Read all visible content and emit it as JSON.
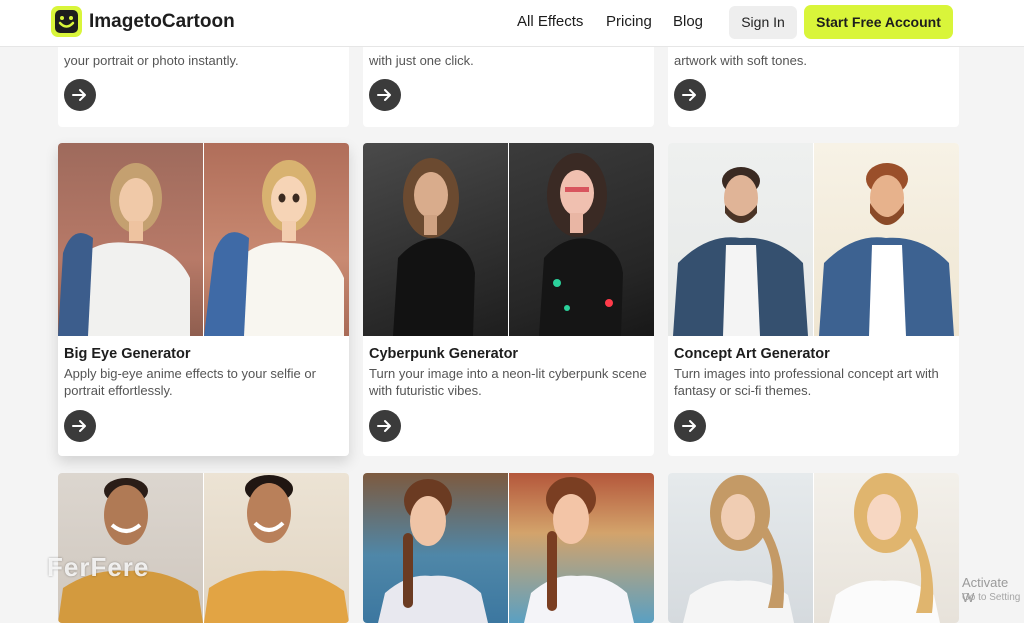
{
  "nav": {
    "brand": "ImagetoCartoon",
    "links": [
      "All Effects",
      "Pricing",
      "Blog"
    ],
    "signin": "Sign In",
    "start": "Start Free Account"
  },
  "top_cards": [
    {
      "desc": "your portrait or photo instantly."
    },
    {
      "desc": "with just one click."
    },
    {
      "desc": "artwork with soft tones."
    }
  ],
  "cards": [
    {
      "title": "Big Eye Generator",
      "desc": "Apply big-eye anime effects to your selfie or portrait effortlessly."
    },
    {
      "title": "Cyberpunk Generator",
      "desc": "Turn your image into a neon-lit cyberpunk scene with futuristic vibes."
    },
    {
      "title": "Concept Art Generator",
      "desc": "Turn images into professional concept art with fantasy or sci-fi themes."
    }
  ],
  "watermark": "FerFere",
  "os_notice": {
    "title": "Activate W",
    "sub": "Go to Setting"
  },
  "colors": {
    "accent": "#d9f53a",
    "button_dark": "#3b3b3b"
  }
}
